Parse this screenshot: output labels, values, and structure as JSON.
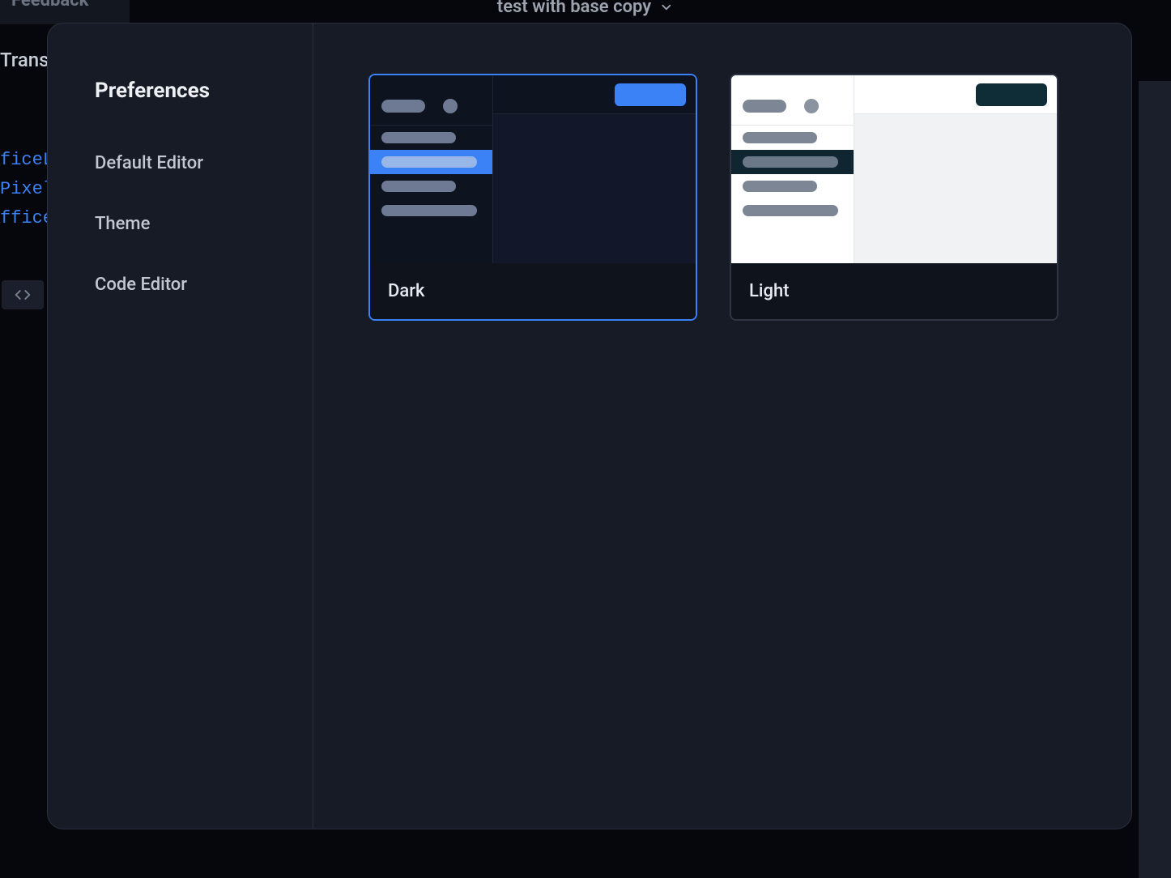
{
  "background": {
    "tab_label": "Feedback",
    "dropdown_label": "test with base copy",
    "side_text": "Trans",
    "code_lines": "ficeL\nPixel\nffice"
  },
  "modal": {
    "title": "Preferences",
    "nav": [
      {
        "label": "Default Editor"
      },
      {
        "label": "Theme"
      },
      {
        "label": "Code Editor"
      }
    ],
    "themes": [
      {
        "id": "dark",
        "label": "Dark",
        "selected": true
      },
      {
        "id": "light",
        "label": "Light",
        "selected": false
      }
    ]
  }
}
